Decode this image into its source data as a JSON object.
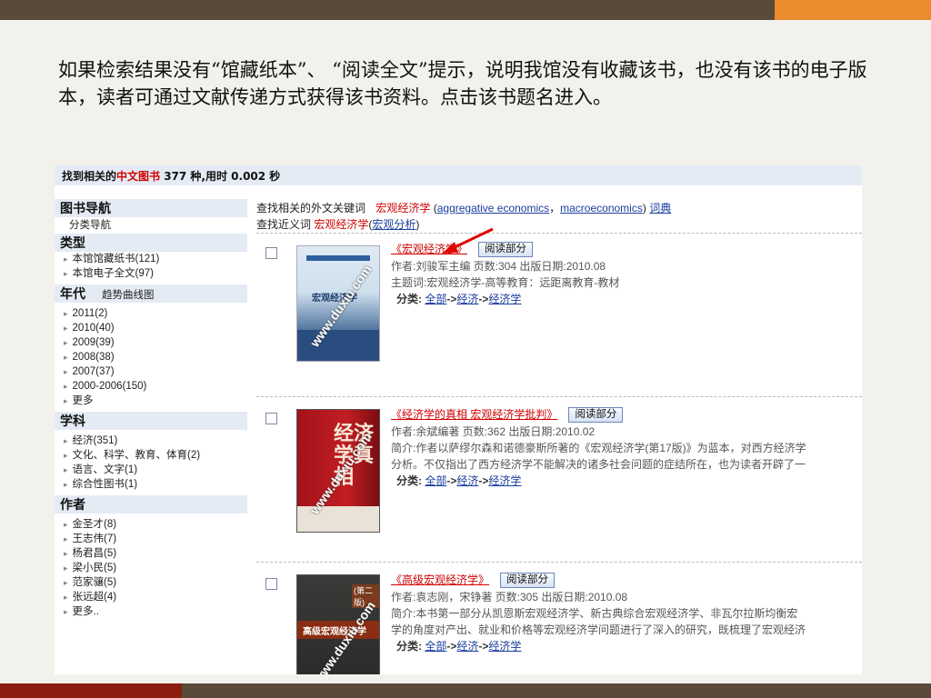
{
  "instruction": "如果检索结果没有“馆藏纸本”、 “阅读全文”提示，说明我馆没有收藏该书，也没有该书的电子版本，读者可通过文献传递方式获得该书资料。点击该书题名进入。",
  "header": {
    "prefix": "找到相关的",
    "highlight": "中文图书",
    "suffix": " 377 种,用时 0.002 秒"
  },
  "sidebar": {
    "nav_title": "图书导航",
    "nav_sub": "分类导航",
    "type_title": "类型",
    "type_items": [
      "本馆馆藏纸书(121)",
      "本馆电子全文(97)"
    ],
    "year_title": "年代",
    "year_link": "趋势曲线图",
    "year_items": [
      "2011(2)",
      "2010(40)",
      "2009(39)",
      "2008(38)",
      "2007(37)",
      "2000-2006(150)",
      "更多"
    ],
    "subject_title": "学科",
    "subject_items": [
      "经济(351)",
      "文化、科学、教育、体育(2)",
      "语言、文字(1)",
      "综合性图书(1)"
    ],
    "author_title": "作者",
    "author_items": [
      "金圣才(8)",
      "王志伟(7)",
      "杨君昌(5)",
      "梁小民(5)",
      "范家骧(5)",
      "张远超(4)",
      "更多.."
    ]
  },
  "keywords": {
    "label": "查找相关的外文关键词",
    "term": "宏观经济学",
    "foreign1": "aggregative economics",
    "sep": "，",
    "foreign2": "macroeconomics",
    "dict": "词典",
    "near_label": "查找近义词",
    "near_term": "宏观经济学",
    "near_link": "宏观分析"
  },
  "books": [
    {
      "title": "《宏观经济学》",
      "read_label": "阅读部分",
      "line1": "作者:刘骏军主编  页数:304  出版日期:2010.08",
      "line2": "主题词:宏观经济学-高等教育：远距离教育-教材",
      "cat_label": "分类:",
      "cat1": "全部",
      "cat2": "经济",
      "cat3": "经济学",
      "cover_text": "宏观经济学",
      "watermark": "www.duxiu.com"
    },
    {
      "title": "《经济学的真相  宏观经济学批判》",
      "read_label": "阅读部分",
      "line1": "作者:余斌编著  页数:362  出版日期:2010.02",
      "line2": "简介:作者以萨缪尔森和诺德豪斯所著的《宏观经济学(第17版)》为蓝本，对西方经济学",
      "line3": "分析。不仅指出了西方经济学不能解决的诸多社会问题的症结所在，也为读者开辟了一",
      "cat_label": "分类:",
      "cat1": "全部",
      "cat2": "经济",
      "cat3": "经济学",
      "cover_text": "经济学真相",
      "watermark": "www.duxiu.com"
    },
    {
      "title": "《高级宏观经济学》",
      "read_label": "阅读部分",
      "line1": "作者:袁志刚，宋铮著  页数:305  出版日期:2010.08",
      "line2": "简介:本书第一部分从凯恩斯宏观经济学、新古典综合宏观经济学、非瓦尔拉斯均衡宏",
      "line3": "学的角度对产出、就业和价格等宏观经济学问题进行了深入的研究，既梳理了宏观经济",
      "cat_label": "分类:",
      "cat1": "全部",
      "cat2": "经济",
      "cat3": "经济学",
      "cover_text": "高级宏观经济学",
      "cover_badge": "(第二版)",
      "watermark": "www.duxiu.com"
    }
  ],
  "colors": {
    "accent": "#ec8a2e",
    "dark": "#5a4a39",
    "red": "#d00000",
    "link": "#1a3d9e",
    "panel": "#e4ebf5"
  }
}
